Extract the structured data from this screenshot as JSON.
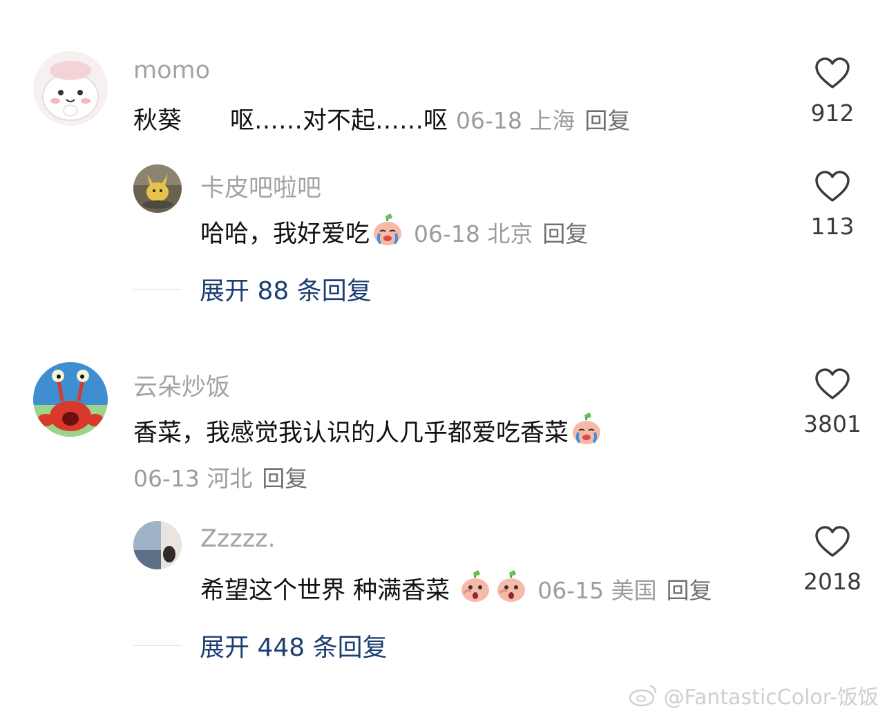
{
  "comments": [
    {
      "username": "momo",
      "text": "秋葵　　呕……对不起……呕",
      "meta": "06-18 上海",
      "reply_label": "回复",
      "likes": "912",
      "avatar": "cartoon-bunny-avatar",
      "replies": [
        {
          "username": "卡皮吧啦吧",
          "text": "哈哈，我好爱吃",
          "emoji": "crying-peach-emoji",
          "meta": "06-18 北京",
          "reply_label": "回复",
          "likes": "113",
          "avatar": "pikachu-avatar"
        }
      ],
      "expand_label": "展开 88 条回复"
    },
    {
      "username": "云朵炒饭",
      "text": "香菜，我感觉我认识的人几乎都爱吃香菜",
      "emoji": "crying-peach-emoji",
      "meta": "06-13 河北",
      "reply_label": "回复",
      "likes": "3801",
      "avatar": "crab-cartoon-avatar",
      "replies": [
        {
          "username": "Zzzzz.",
          "text": "希望这个世界 种满香菜",
          "emoji": "shocked-peach-emoji",
          "meta": "06-15 美国",
          "reply_label": "回复",
          "likes": "2018",
          "avatar": "window-scenery-avatar"
        }
      ],
      "expand_label": "展开 448 条回复"
    }
  ],
  "watermark": "@FantasticColor-饭饭",
  "colors": {
    "username": "#a3a3a3",
    "meta": "#9c9c9c",
    "expand_link": "#1c3e72",
    "like_icon": "#3b3b3b"
  }
}
